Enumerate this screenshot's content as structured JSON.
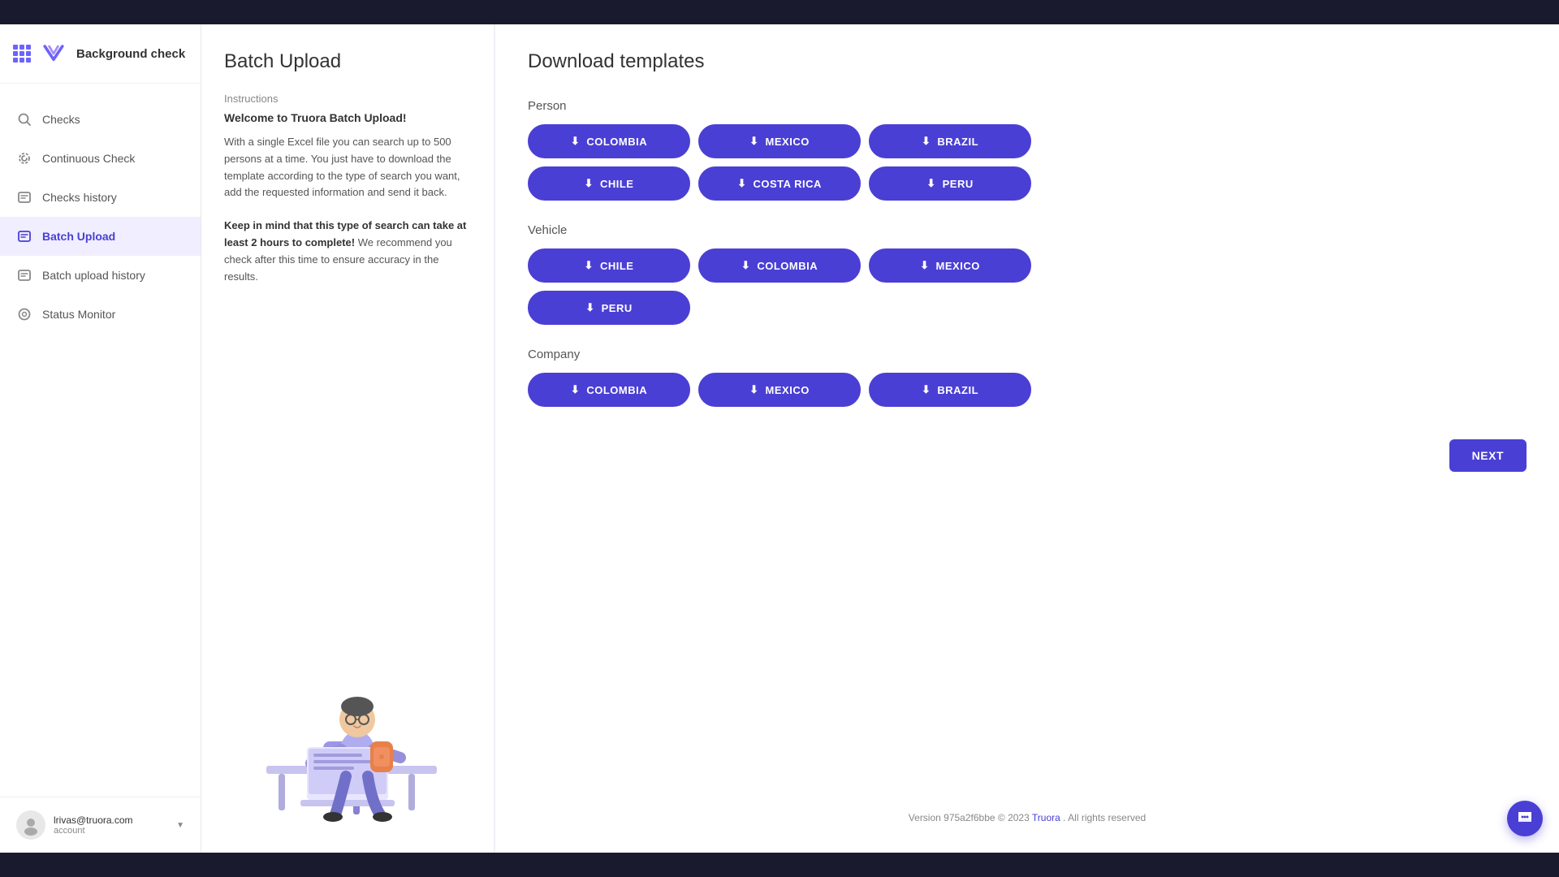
{
  "app": {
    "title": "Background check",
    "top_bar_color": "#1a1a2e"
  },
  "sidebar": {
    "nav_items": [
      {
        "id": "checks",
        "label": "Checks",
        "active": false
      },
      {
        "id": "continuous-check",
        "label": "Continuous Check",
        "active": false
      },
      {
        "id": "checks-history",
        "label": "Checks history",
        "active": false
      },
      {
        "id": "batch-upload",
        "label": "Batch Upload",
        "active": true
      },
      {
        "id": "batch-upload-history",
        "label": "Batch upload history",
        "active": false
      },
      {
        "id": "status-monitor",
        "label": "Status Monitor",
        "active": false
      }
    ],
    "user": {
      "email": "lrivas@truora.com",
      "account_label": "account"
    }
  },
  "batch_panel": {
    "title": "Batch Upload",
    "instructions_label": "Instructions",
    "welcome": "Welcome to Truora Batch Upload!",
    "desc1": "With a single Excel file you can search up to 500 persons at a time. You just have to download the template according to the type of search you want, add the requested information and send it back.",
    "warning_text": "Keep in mind that this type of search can take at least 2 hours to complete!",
    "warning_suffix": " We recommend you check after this time to ensure accuracy in the results."
  },
  "templates_panel": {
    "title": "Download templates",
    "person_label": "Person",
    "person_buttons": [
      {
        "country": "COLOMBIA"
      },
      {
        "country": "MEXICO"
      },
      {
        "country": "BRAZIL"
      },
      {
        "country": "CHILE"
      },
      {
        "country": "COSTA RICA"
      },
      {
        "country": "PERU"
      }
    ],
    "vehicle_label": "Vehicle",
    "vehicle_buttons": [
      {
        "country": "CHILE"
      },
      {
        "country": "COLOMBIA"
      },
      {
        "country": "MEXICO"
      },
      {
        "country": "PERU"
      }
    ],
    "company_label": "Company",
    "company_buttons": [
      {
        "country": "COLOMBIA"
      },
      {
        "country": "MEXICO"
      },
      {
        "country": "BRAZIL"
      }
    ],
    "next_button": "NEXT"
  },
  "footer": {
    "text": "Version 975a2f6bbe © 2023",
    "link_text": "Truora",
    "suffix": ". All rights reserved"
  }
}
